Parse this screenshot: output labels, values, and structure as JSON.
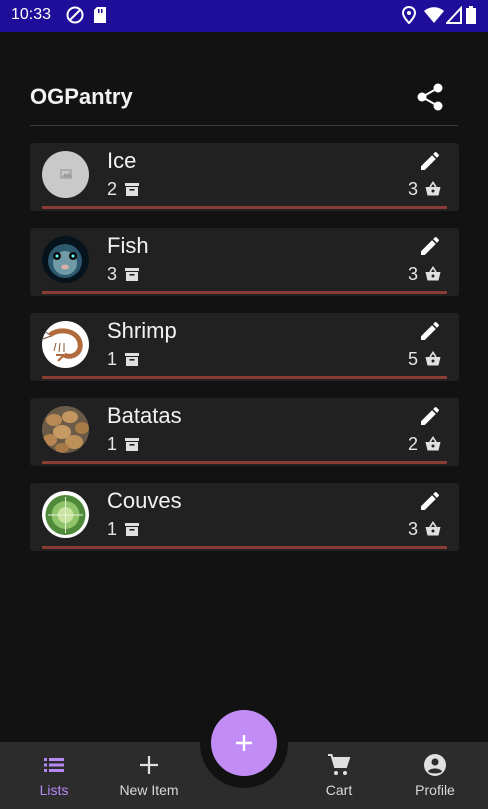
{
  "status_bar": {
    "time": "10:33",
    "icons": [
      "at-sign-icon",
      "sd-card-icon",
      "location-icon",
      "wifi-icon",
      "signal-icon",
      "battery-icon"
    ],
    "background": "#1f0e99"
  },
  "header": {
    "title": "OGPantry",
    "share_icon": "share-icon"
  },
  "items": [
    {
      "name": "Ice",
      "stock_count": "2",
      "cart_count": "3",
      "image": "placeholder-image"
    },
    {
      "name": "Fish",
      "stock_count": "3",
      "cart_count": "3",
      "image": "pufferfish"
    },
    {
      "name": "Shrimp",
      "stock_count": "1",
      "cart_count": "5",
      "image": "shrimp"
    },
    {
      "name": "Batatas",
      "stock_count": "1",
      "cart_count": "2",
      "image": "potatoes"
    },
    {
      "name": "Couves",
      "stock_count": "1",
      "cart_count": "3",
      "image": "cabbage"
    }
  ],
  "bottom_nav": {
    "lists": "Lists",
    "new_item": "New Item",
    "cart": "Cart",
    "profile": "Profile"
  },
  "colors": {
    "accent": "#c28cf7",
    "active_nav": "#b68af5",
    "card": "#212121",
    "progress": "#8a3b33",
    "background": "#121212"
  }
}
